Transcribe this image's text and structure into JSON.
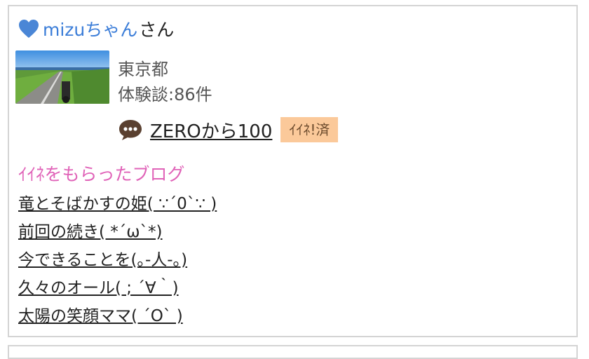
{
  "user": {
    "name": "mizuちゃん",
    "suffix": "さん",
    "location": "東京都",
    "experience_count": "体験談:86件"
  },
  "blog": {
    "title": "ZEROから100",
    "iine_badge": "ｲｲﾈ!済"
  },
  "liked_section": {
    "title": "ｲｲﾈをもらったブログ",
    "items": [
      "竜とそばかすの姫(  ∵´0`∵  )",
      "前回の続き( *´ω`*)",
      "今できることを(｡-人-｡)",
      "久々のオール( ; ´∀｀)",
      "太陽の笑顔ママ( ´O` )"
    ]
  },
  "colors": {
    "username": "#3b7dd8",
    "heart": "#4a86d6",
    "section_title": "#e063b8",
    "badge_bg": "#fbc99a",
    "bubble": "#5a4030"
  },
  "icons": {
    "heart": "heart-icon",
    "comment": "speech-bubble-icon"
  }
}
